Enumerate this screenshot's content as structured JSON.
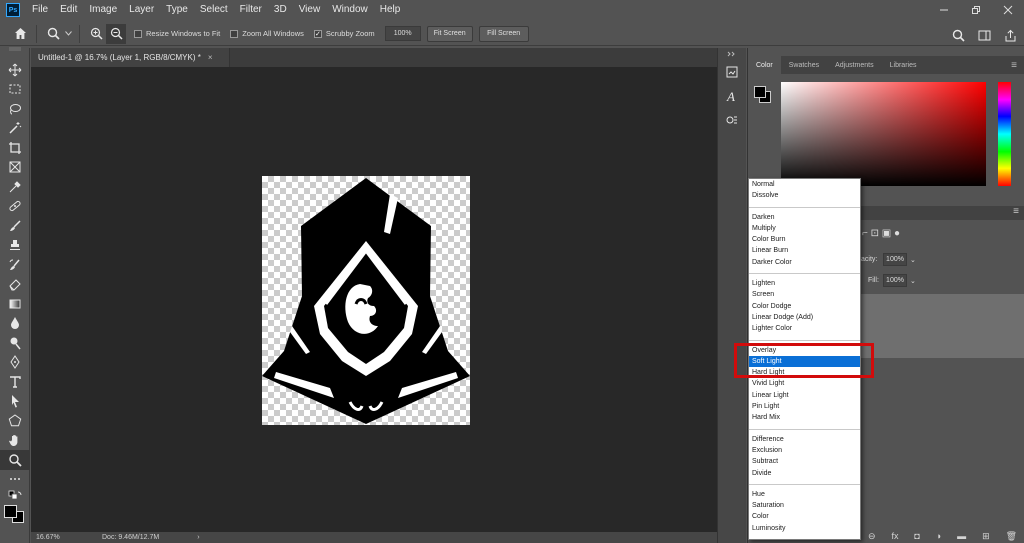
{
  "app_logo": "Ps",
  "menu": [
    "File",
    "Edit",
    "Image",
    "Layer",
    "Type",
    "Select",
    "Filter",
    "3D",
    "View",
    "Window",
    "Help"
  ],
  "options_bar": {
    "resize_windows": "Resize Windows to Fit",
    "zoom_all": "Zoom All Windows",
    "scrubby_zoom": "Scrubby Zoom",
    "zoom_value": "100%",
    "fit_screen": "Fit Screen",
    "fill_screen": "Fill Screen"
  },
  "document_tab": {
    "title": "Untitled-1 @ 16.7% (Layer 1, RGB/8/CMYK) *",
    "close": "×"
  },
  "status_bar": {
    "zoom": "16.67%",
    "doc": "Doc: 9.46M/12.7M",
    "arrow": "›"
  },
  "color_panel": {
    "tabs": [
      "Color",
      "Swatches",
      "Adjustments",
      "Libraries"
    ],
    "active_tab": "Color",
    "fg_color": "#000000",
    "bg_color": "#000000"
  },
  "layers_panel": {
    "opacity_label": "acity:",
    "opacity_value": "100%",
    "fill_label": "Fill:",
    "fill_value": "100%"
  },
  "blend_modes": {
    "groups": [
      [
        "Normal",
        "Dissolve"
      ],
      [
        "Darken",
        "Multiply",
        "Color Burn",
        "Linear Burn",
        "Darker Color"
      ],
      [
        "Lighten",
        "Screen",
        "Color Dodge",
        "Linear Dodge (Add)",
        "Lighter Color"
      ],
      [
        "Overlay",
        "Soft Light",
        "Hard Light",
        "Vivid Light",
        "Linear Light",
        "Pin Light",
        "Hard Mix"
      ],
      [
        "Difference",
        "Exclusion",
        "Subtract",
        "Divide"
      ],
      [
        "Hue",
        "Saturation",
        "Color",
        "Luminosity"
      ]
    ],
    "selected": "Soft Light"
  },
  "icons": {
    "home": "home-icon",
    "zoom_tool": "magnifier-icon",
    "zoom_in": "zoom-in-icon",
    "zoom_out": "zoom-out-icon",
    "search": "search-icon",
    "workspace": "workspace-icon",
    "share": "share-icon"
  },
  "colors": {
    "highlight": "#d20b0b",
    "selection": "#0a6fd6"
  }
}
